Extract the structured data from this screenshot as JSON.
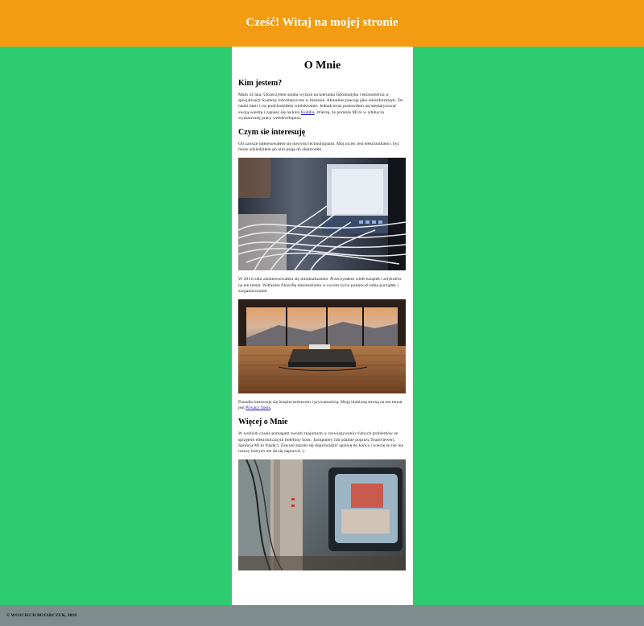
{
  "header": {
    "title": "Cześć! Witaj na mojej stronie"
  },
  "main": {
    "title": "O Mnie",
    "section1": {
      "heading": "Kim jestem?",
      "text_before_link": "Mam 34 lata. Ukończyłem studia wyższe na kierunku Informatyka i ekonometria w specjalizacji Systemy informatyczne w biznesie. Aktualnie pracuję jako teleinformatyk. Do nauki html i css podchodziłem wielokrotnie. Jednak teraz postawiłem usystematyzować swoją wiedzę i zapisać się na kurs ",
      "link": "Kodilla",
      "text_after_link": ". Wierzę, że pomoże Mi to w zdobyciu wymarzonej pracy webdevelopera."
    },
    "section2": {
      "heading": "Czym sie interesuję",
      "text1": "Od zawsze interesowałem się nowymi technologiami. Mój ojciec jest elektronikiem i być może odziedziłem po nim pasję do elektroniki.",
      "image1_alt": "server-rack-cables",
      "text2": "W 2014 roku zainteresowałem się minimalizmem. Przeczytałem wiele książek i artykułów na ten temat. Wdrażam filozofię minimalizmu w swoim życiu ponieważ lubię porządek i zorganizowanie.",
      "image2_alt": "minimalist-room-mountain-view",
      "text3_before_link": "Ponadto interesuje się bezpieczeństwem i prywatnością. Moją ulubioną stroną na ten temat jest ",
      "link": "Privacy Tools",
      "text3_after_link": "."
    },
    "section3": {
      "heading": "Więcej o Mnie",
      "text": "W wolnym czasie pomagam swoim znajomym w rozwiązywaniu różnych problemów ze sprzętem elektronicznym (telefony kom., komputery lub zdalnie poprzez Teamviewer). Sprawia Mi to frajdę:). Zawsze staram się doprowadzić sprawę do końca i wierzę że nie ma rzeczy których nie da się naprawić :)",
      "image3_alt": "old-tv-electronics"
    }
  },
  "footer": {
    "text": "© WOJCIECH BOJARCZUK, 2018"
  },
  "colors": {
    "header_bg": "#f39c12",
    "page_bg": "#2ecc71",
    "footer_bg": "#7f8c8d",
    "content_bg": "#ffffff"
  }
}
